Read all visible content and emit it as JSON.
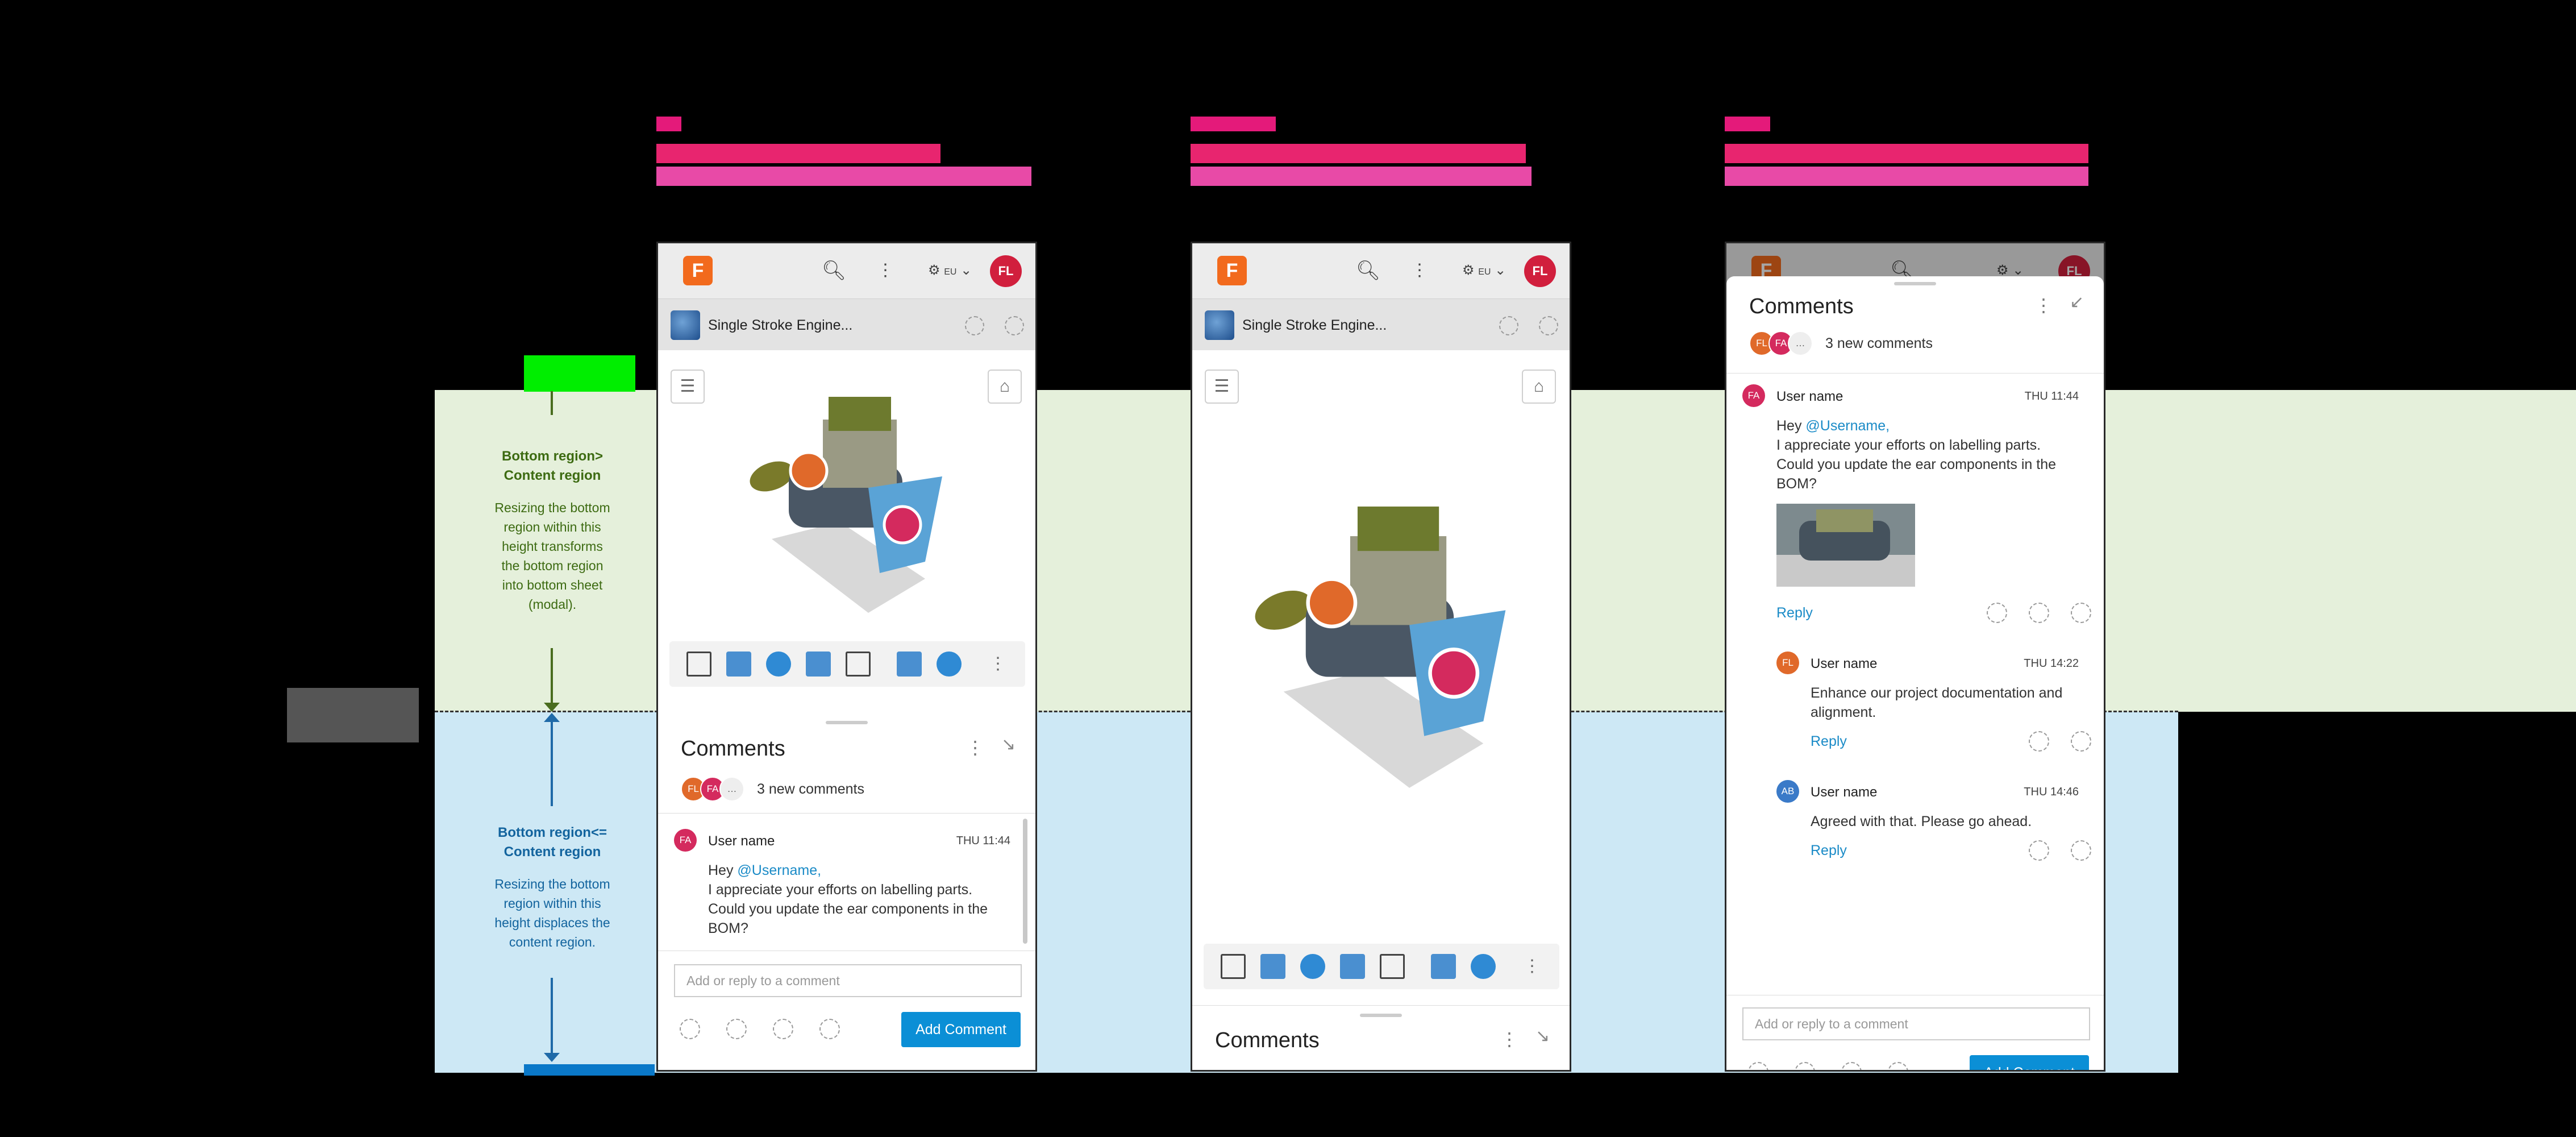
{
  "colors": {
    "green_band": "#e5f0db",
    "blue_band": "#cde8f5",
    "brand": "#f26a1d",
    "accent": "#0b8fd6",
    "mention": "#1b8bc7"
  },
  "annotations": {
    "top_heading_1": "Bottom region>",
    "top_heading_2": "Content region",
    "top_body": [
      "Resizing the bottom",
      "region within this",
      "height transforms",
      "the bottom region",
      "into bottom sheet",
      "(modal)."
    ],
    "bottom_heading_1": "Bottom region<=",
    "bottom_heading_2": "Content region",
    "bottom_body": [
      "Resizing the bottom",
      "region within this",
      "height displaces the",
      "content region."
    ]
  },
  "app": {
    "logo_letter": "F",
    "avatar": "FL",
    "search_icon": "search-icon",
    "region_label": "EU",
    "doc_title": "Single Stroke Engine...",
    "comments_title": "Comments",
    "new_comments": "3 new comments",
    "mini_avatars": [
      "FL",
      "FA"
    ],
    "input_placeholder": "Add or reply to a comment",
    "add_comment": "Add Comment",
    "reply": "Reply"
  },
  "comments": [
    {
      "initials": "FA",
      "user": "User name",
      "time": "THU 11:44",
      "mention": "@Username,",
      "greeting": "Hey ",
      "lines": [
        "I appreciate your efforts on labelling parts.",
        "Could you update the ear components in the",
        "BOM?"
      ]
    },
    {
      "initials": "FL",
      "user": "User name",
      "time": "THU 14:22",
      "lines": [
        "Enhance our project documentation and",
        "alignment."
      ]
    },
    {
      "initials": "AB",
      "user": "User name",
      "time": "THU 14:46",
      "lines": [
        "Agreed with that. Please go ahead."
      ]
    }
  ]
}
